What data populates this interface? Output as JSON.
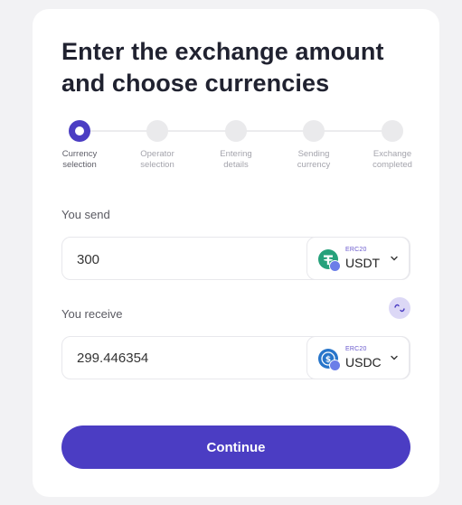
{
  "header": {
    "title": "Enter the exchange amount and choose currencies"
  },
  "steps": [
    {
      "label_line1": "Currency",
      "label_line2": "selection",
      "state": "active"
    },
    {
      "label_line1": "Operator",
      "label_line2": "selection",
      "state": "pending"
    },
    {
      "label_line1": "Entering",
      "label_line2": "details",
      "state": "pending"
    },
    {
      "label_line1": "Sending",
      "label_line2": "currency",
      "state": "pending"
    },
    {
      "label_line1": "Exchange",
      "label_line2": "completed",
      "state": "pending"
    }
  ],
  "send": {
    "label": "You send",
    "amount": "300",
    "currency": {
      "network": "ERC20",
      "ticker": "USDT",
      "icon": "tether-icon",
      "color": "#26a17b"
    }
  },
  "receive": {
    "label": "You receive",
    "amount": "299.446354",
    "currency": {
      "network": "ERC20",
      "ticker": "USDC",
      "icon": "usdc-icon",
      "color": "#2775ca"
    }
  },
  "swap_button": {
    "icon": "swap-icon"
  },
  "continue_button": {
    "label": "Continue"
  },
  "colors": {
    "accent": "#4b3dc3",
    "swap_bg": "#dcd8f6",
    "background": "#f2f2f4",
    "card": "#ffffff"
  }
}
